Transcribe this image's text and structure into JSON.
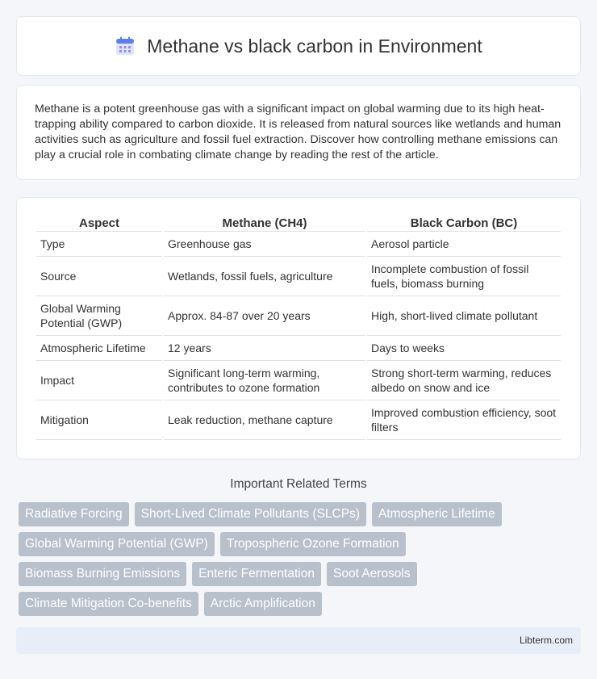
{
  "header": {
    "title": "Methane vs black carbon in Environment",
    "icon": "calendar-icon",
    "icon_color": "#5b7ee8"
  },
  "intro": {
    "text": "Methane is a potent greenhouse gas with a significant impact on global warming due to its high heat-trapping ability compared to carbon dioxide. It is released from natural sources like wetlands and human activities such as agriculture and fossil fuel extraction. Discover how controlling methane emissions can play a crucial role in combating climate change by reading the rest of the article."
  },
  "table": {
    "headers": [
      "Aspect",
      "Methane (CH4)",
      "Black Carbon (BC)"
    ],
    "rows": [
      [
        "Type",
        "Greenhouse gas",
        "Aerosol particle"
      ],
      [
        "Source",
        "Wetlands, fossil fuels, agriculture",
        "Incomplete combustion of fossil fuels, biomass burning"
      ],
      [
        "Global Warming Potential (GWP)",
        "Approx. 84-87 over 20 years",
        "High, short-lived climate pollutant"
      ],
      [
        "Atmospheric Lifetime",
        "12 years",
        "Days to weeks"
      ],
      [
        "Impact",
        "Significant long-term warming, contributes to ozone formation",
        "Strong short-term warming, reduces albedo on snow and ice"
      ],
      [
        "Mitigation",
        "Leak reduction, methane capture",
        "Improved combustion efficiency, soot filters"
      ]
    ]
  },
  "related": {
    "title": "Important Related Terms",
    "tags": [
      "Radiative Forcing",
      "Short-Lived Climate Pollutants (SLCPs)",
      "Atmospheric Lifetime",
      "Global Warming Potential (GWP)",
      "Tropospheric Ozone Formation",
      "Biomass Burning Emissions",
      "Enteric Fermentation",
      "Soot Aerosols",
      "Climate Mitigation Co-benefits",
      "Arctic Amplification"
    ],
    "tag_color": "#b8c0cc"
  },
  "footer": {
    "text": "Libterm.com"
  }
}
